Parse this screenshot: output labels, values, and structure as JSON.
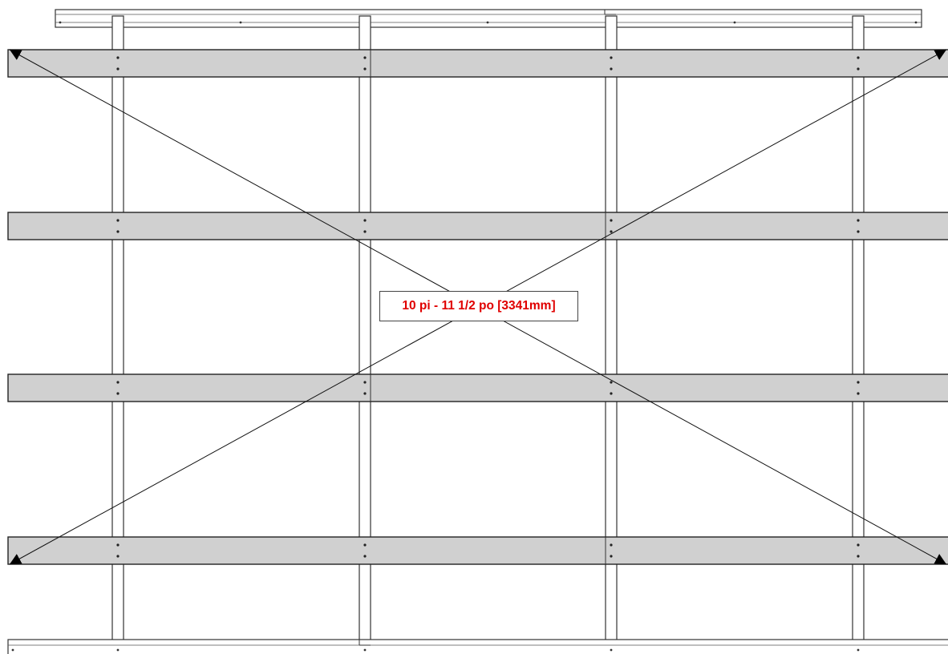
{
  "diagram": {
    "dimension_label": "10 pi - 11 1/2 po [3341mm]",
    "colors": {
      "beam_fill": "#d0d0d0",
      "line": "#333333",
      "dimension_text": "#e00000",
      "background": "#ffffff"
    }
  }
}
